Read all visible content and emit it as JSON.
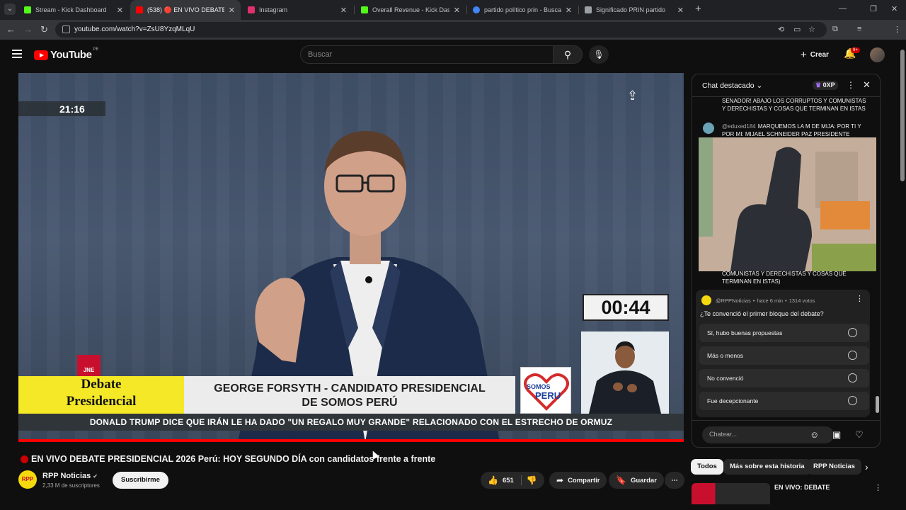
{
  "browser": {
    "tabs": [
      {
        "title": "Stream - Kick Dashboard",
        "color": "#53fc18"
      },
      {
        "title": "(538) 🔴 EN VIVO DEBATE P",
        "color": "#ff0000"
      },
      {
        "title": "Instagram",
        "color": "#e1306c"
      },
      {
        "title": "Overall Revenue - Kick Dashbo",
        "color": "#53fc18"
      },
      {
        "title": "partido político prin - Buscar co",
        "color": "#4285f4"
      },
      {
        "title": "Significado PRIN partido",
        "color": "#9aa0a6"
      }
    ],
    "url": "youtube.com/watch?v=ZsU8YzqMLqU"
  },
  "header": {
    "logo": "YouTube",
    "country": "PE",
    "search_placeholder": "Buscar",
    "create_label": "Crear",
    "notifications_badge": "9+"
  },
  "player": {
    "clock": "21:16",
    "timer": "00:44",
    "jne_label": "JNE",
    "lower_left_line1": "Debate",
    "lower_left_line2": "Presidencial",
    "lower_mid_line1": "GEORGE FORSYTH - CANDIDATO PRESIDENCIAL",
    "lower_mid_line2": "DE SOMOS PERÚ",
    "party_logo_line1": "SOMOS",
    "party_logo_line2": "PERU",
    "ticker": "DONALD TRUMP DICE QUE IRÁN LE HA DADO \"UN REGALO MUY GRANDE\" RELACIONADO CON EL ESTRECHO DE ORMUZ",
    "progress_fraction": 1.0
  },
  "video": {
    "title": "EN VIVO DEBATE PRESIDENCIAL 2026 Perú: HOY SEGUNDO DÍA con candidatos frente a frente",
    "channel_name": "RPP Noticias",
    "channel_avatar_text": "RPP",
    "subscribers": "2,33 M de suscriptores",
    "subscribe_label": "Suscribirme",
    "likes": "651",
    "share_label": "Compartir",
    "save_label": "Guardar"
  },
  "chat": {
    "title": "Chat destacado",
    "points": "0XP",
    "messages": [
      {
        "user": "",
        "text": "SENADOR! ABAJO LOS CORRUPTOS Y COMUNISTAS Y DERECHISTAS Y COSAS QUE TERMINAN EN ISTAS"
      },
      {
        "user": "@eduxed184",
        "text": "MARQUEMOS LA M DE MIJA: POR TI Y POR MI: MIJAEL SCHNEIDER PAZ PRESIDENTE"
      },
      {
        "user": "",
        "text": "COMUNISTAS Y DERECHISTAS Y COSAS QUE TERMINAN EN ISTAS)"
      }
    ],
    "poll": {
      "author": "@RPPNoticias",
      "time": "hace 6 min",
      "votes": "1314 votos",
      "question": "¿Te convenció el primer bloque del debate?",
      "options": [
        "Sí, hubo buenas propuestas",
        "Más o menos",
        "No convenció",
        "Fue decepcionante"
      ]
    },
    "input_placeholder": "Chatear..."
  },
  "related": {
    "chips": [
      "Todos",
      "Más sobre esta historia",
      "RPP Noticias"
    ],
    "first_title": "EN VIVO: DEBATE"
  }
}
